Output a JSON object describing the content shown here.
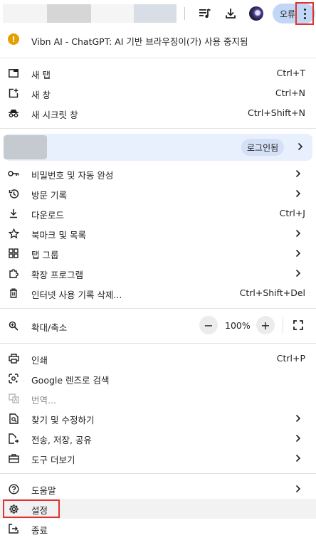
{
  "toolbar": {
    "profile_label": "오류",
    "icons": [
      "media-controls-icon",
      "download-icon",
      "avatar",
      "more-menu-icon"
    ]
  },
  "warning": {
    "text": "Vibn AI - ChatGPT: AI 기반 브라우징이(가) 사용 중지됨",
    "icon": "warning-icon",
    "icon_color": "#e3a000"
  },
  "group1": [
    {
      "label": "새 탭",
      "shortcut": "Ctrl+T",
      "icon": "new-tab-icon"
    },
    {
      "label": "새 창",
      "shortcut": "Ctrl+N",
      "icon": "new-window-icon"
    },
    {
      "label": "새 시크릿 창",
      "shortcut": "Ctrl+Shift+N",
      "icon": "incognito-icon"
    }
  ],
  "profile": {
    "login_label": "로그인됨"
  },
  "group2": [
    {
      "label": "비밀번호 및 자동 완성",
      "icon": "key-icon"
    },
    {
      "label": "방문 기록",
      "icon": "history-icon"
    },
    {
      "label": "다운로드",
      "shortcut": "Ctrl+J",
      "icon": "download-icon"
    },
    {
      "label": "북마크 및 목록",
      "icon": "star-icon"
    },
    {
      "label": "탭 그룹",
      "icon": "tab-groups-icon"
    },
    {
      "label": "확장 프로그램",
      "icon": "extension-icon"
    },
    {
      "label": "인터넷 사용 기록 삭제...",
      "shortcut": "Ctrl+Shift+Del",
      "icon": "trash-icon"
    }
  ],
  "zoom": {
    "label": "확대/축소",
    "value": "100%",
    "minus": "−",
    "plus": "+"
  },
  "group3": [
    {
      "label": "인쇄",
      "shortcut": "Ctrl+P",
      "icon": "print-icon"
    },
    {
      "label": "Google 렌즈로 검색",
      "icon": "lens-icon"
    },
    {
      "label": "번역...",
      "icon": "translate-icon"
    },
    {
      "label": "찾기 및 수정하기",
      "icon": "find-edit-icon"
    },
    {
      "label": "전송, 저장, 공유",
      "icon": "share-icon"
    },
    {
      "label": "도구 더보기",
      "icon": "toolbox-icon"
    }
  ],
  "group4": [
    {
      "label": "도움말",
      "icon": "help-icon"
    },
    {
      "label": "설정",
      "icon": "settings-icon"
    },
    {
      "label": "종료",
      "icon": "exit-icon"
    }
  ],
  "colors": {
    "highlight_border": "#e0332f",
    "profile_bg": "#e9f0fd",
    "profile_pill": "#c2d7f5"
  }
}
